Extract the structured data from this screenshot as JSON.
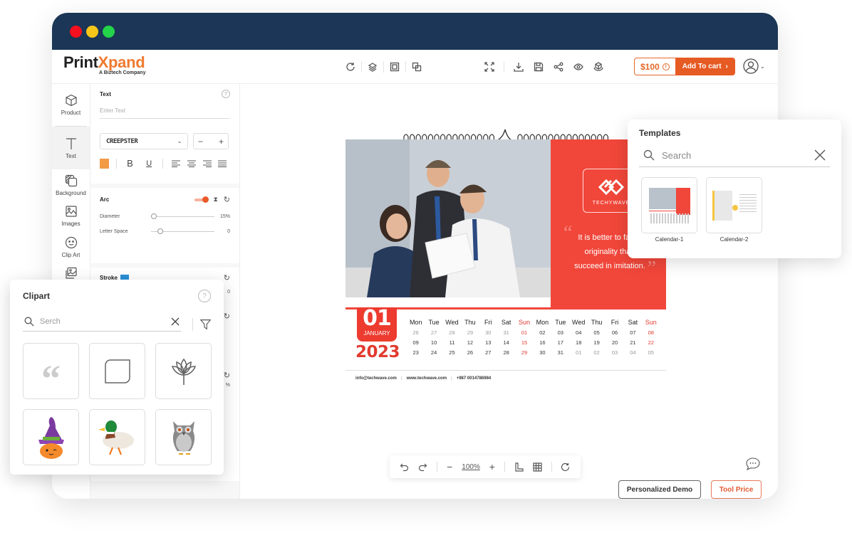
{
  "window": {
    "controls": [
      "close",
      "minimize",
      "maximize"
    ]
  },
  "header": {
    "logo": {
      "part1": "Print",
      "part2": "Xpand",
      "tagline": "A Biztech Company"
    },
    "toolbar_left": [
      {
        "icon": "history-icon",
        "label": "History"
      },
      {
        "icon": "layers-icon",
        "label": "Layers"
      },
      {
        "icon": "bring-front-icon",
        "label": "Bring to Front"
      },
      {
        "icon": "send-back-icon",
        "label": "Send to Back"
      }
    ],
    "toolbar_right": [
      {
        "icon": "fullscreen-icon",
        "label": "Fullscreen"
      },
      {
        "icon": "download-icon",
        "label": "Download"
      },
      {
        "icon": "save-icon",
        "label": "Save"
      },
      {
        "icon": "share-icon",
        "label": "Share"
      },
      {
        "icon": "preview-icon",
        "label": "Preview"
      },
      {
        "icon": "3d-view-icon",
        "label": "3D View"
      }
    ],
    "price": "$100",
    "add_to_cart": "Add To cart"
  },
  "rail": {
    "items": [
      {
        "label": "Product",
        "icon": "cube-icon",
        "active": false
      },
      {
        "label": "Text",
        "icon": "text-icon",
        "active": true
      },
      {
        "label": "Background",
        "icon": "background-icon",
        "active": false
      },
      {
        "label": "Images",
        "icon": "image-icon",
        "active": false
      },
      {
        "label": "Clip Art",
        "icon": "smiley-icon",
        "active": false
      },
      {
        "label": "Templates",
        "icon": "templates-icon",
        "active": false
      }
    ]
  },
  "text_panel": {
    "title": "Text",
    "input_placeholder": "Enter Text",
    "input_value": "",
    "font": "CREEPSTER",
    "size_minus": "−",
    "size_plus": "+",
    "text_color": "#f39a45",
    "bold": "B",
    "underline": "U",
    "alignments": [
      "left",
      "center",
      "right",
      "justify"
    ]
  },
  "arc_panel": {
    "title": "Arc",
    "enabled": true,
    "diameter_label": "Diameter",
    "diameter_value": "15%",
    "diameter_fraction": 0.05,
    "letter_space_label": "Letter Space",
    "letter_space_value": "0",
    "letter_space_fraction": 0.15
  },
  "stroke_panel": {
    "title": "Stroke",
    "color": "#2a8fd6",
    "partial_values": [
      "0",
      "%"
    ]
  },
  "calendar": {
    "brand": "TECHYWAVE",
    "quote": "It is better to fail in originality than succeed in imitation.",
    "quote_lines": [
      "It is better to fail in",
      "originality than",
      "succeed in imitation."
    ],
    "day": "01",
    "month": "JANUARY",
    "year": "2023",
    "headers": [
      "Mon",
      "Tue",
      "Wed",
      "Thu",
      "Fri",
      "Sat",
      "Sun",
      "Mon",
      "Tue",
      "Wed",
      "Thu",
      "Fri",
      "Sat",
      "Sun"
    ],
    "rows": [
      [
        "26",
        "27",
        "28",
        "29",
        "30",
        "31",
        "01",
        "02",
        "03",
        "04",
        "05",
        "06",
        "07",
        "08"
      ],
      [
        "09",
        "10",
        "11",
        "12",
        "13",
        "14",
        "15",
        "16",
        "17",
        "18",
        "19",
        "20",
        "21",
        "22"
      ],
      [
        "23",
        "24",
        "25",
        "26",
        "27",
        "28",
        "29",
        "30",
        "31",
        "01",
        "02",
        "03",
        "04",
        "05"
      ]
    ],
    "muted_cells": [
      [
        0,
        0
      ],
      [
        0,
        1
      ],
      [
        0,
        2
      ],
      [
        0,
        3
      ],
      [
        0,
        4
      ],
      [
        0,
        5
      ],
      [
        2,
        9
      ],
      [
        2,
        10
      ],
      [
        2,
        11
      ],
      [
        2,
        12
      ],
      [
        2,
        13
      ]
    ],
    "footer": {
      "email": "info@techwave.com",
      "website": "www.techwave.com",
      "phone": "+987 0014786984"
    }
  },
  "zoombar": {
    "zoom": "100%"
  },
  "buttons": {
    "demo": "Personalized Demo",
    "tool_price": "Tool Price"
  },
  "templates": {
    "title": "Templates",
    "search_placeholder": "Search",
    "items": [
      {
        "label": "Calendar-1"
      },
      {
        "label": "Calendar-2"
      }
    ]
  },
  "clipart": {
    "title": "Clipart",
    "search_placeholder": "Serch",
    "items": [
      {
        "name": "quote-mark"
      },
      {
        "name": "rounded-square"
      },
      {
        "name": "lotus"
      },
      {
        "name": "pumpkin-witch"
      },
      {
        "name": "mallard-duck"
      },
      {
        "name": "owl"
      }
    ]
  },
  "colors": {
    "titlebar": "#1b3656",
    "accent": "#e65a23",
    "calendar_red": "#f1473a"
  }
}
